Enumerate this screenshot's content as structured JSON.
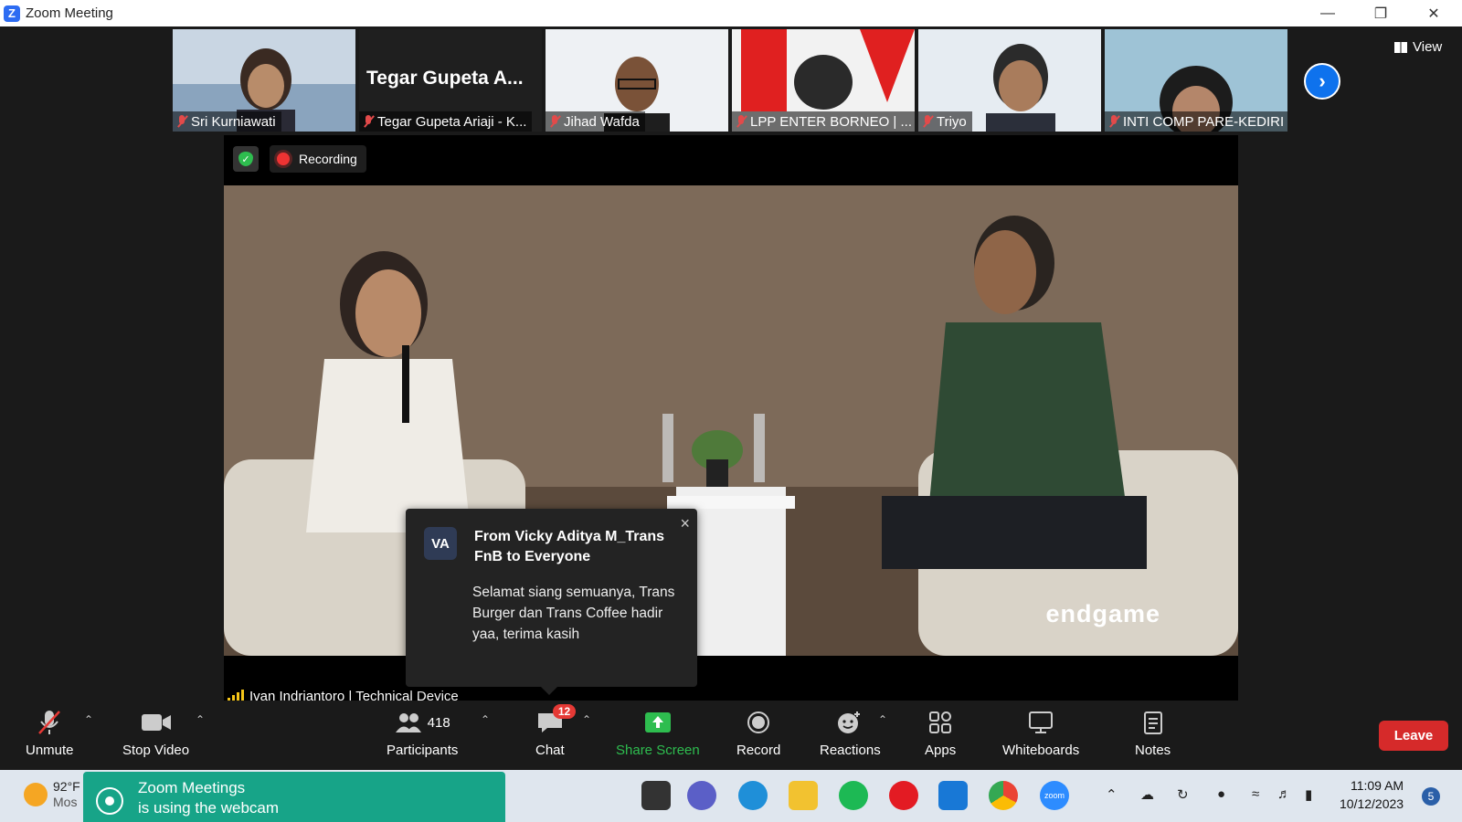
{
  "window": {
    "title": "Zoom Meeting",
    "logo": "Z"
  },
  "participants_strip": [
    {
      "name": "Sri Kurniawati",
      "type": "video",
      "color": "#dfe7ef"
    },
    {
      "name": "Tegar Gupeta Ariaji - K...",
      "type": "name",
      "big_name": "Tegar  Gupeta  A..."
    },
    {
      "name": "Jihad Wafda",
      "type": "video",
      "color": "#e9edf1"
    },
    {
      "name": "LPP ENTER BORNEO | ...",
      "type": "video",
      "color": "#e02020"
    },
    {
      "name": "Triyo",
      "type": "video",
      "color": "#e6ecf2"
    },
    {
      "name": "INTI COMP PARE-KEDIRI",
      "type": "video",
      "color": "#8fb7cc"
    }
  ],
  "view_button": {
    "label": "View"
  },
  "next_page_icon": "chevron-right-icon",
  "recording": {
    "label": "Recording"
  },
  "main_video": {
    "watermark": "endgame",
    "speaker": "Ivan Indriantoro | Technical Device"
  },
  "chat_popup": {
    "avatar": "VA",
    "from": "From Vicky Aditya M_Trans FnB to Everyone",
    "message": "Selamat siang semuanya, Trans Burger dan Trans Coffee hadir yaa, terima kasih",
    "close": "×"
  },
  "toolbar": {
    "unmute": "Unmute",
    "stop_video": "Stop Video",
    "participants": "Participants",
    "participants_count": "418",
    "chat": "Chat",
    "chat_badge": "12",
    "share_screen": "Share Screen",
    "record": "Record",
    "reactions": "Reactions",
    "apps": "Apps",
    "whiteboards": "Whiteboards",
    "notes": "Notes",
    "leave": "Leave"
  },
  "taskbar": {
    "weather_temp": "92°F",
    "weather_sub": "Mos",
    "toast_line1": "Zoom Meetings",
    "toast_line2": "is using the webcam",
    "time": "11:09 AM",
    "date": "10/12/2023",
    "notifications": "5",
    "apps": [
      {
        "name": "file-explorer-icon",
        "color": "#f2c230"
      },
      {
        "name": "edge-icon",
        "color": "#1f8fd8"
      },
      {
        "name": "spotify-icon",
        "color": "#1db954"
      },
      {
        "name": "opera-icon",
        "color": "#e31b23"
      },
      {
        "name": "mail-icon",
        "color": "#1878d6"
      },
      {
        "name": "chrome-icon",
        "color": "#34a853"
      },
      {
        "name": "zoom-icon",
        "color": "#2d8cff"
      }
    ]
  },
  "colors": {
    "accent": "#0e72ed",
    "share_green": "#2ebd4f",
    "leave_red": "#d62a2a"
  }
}
